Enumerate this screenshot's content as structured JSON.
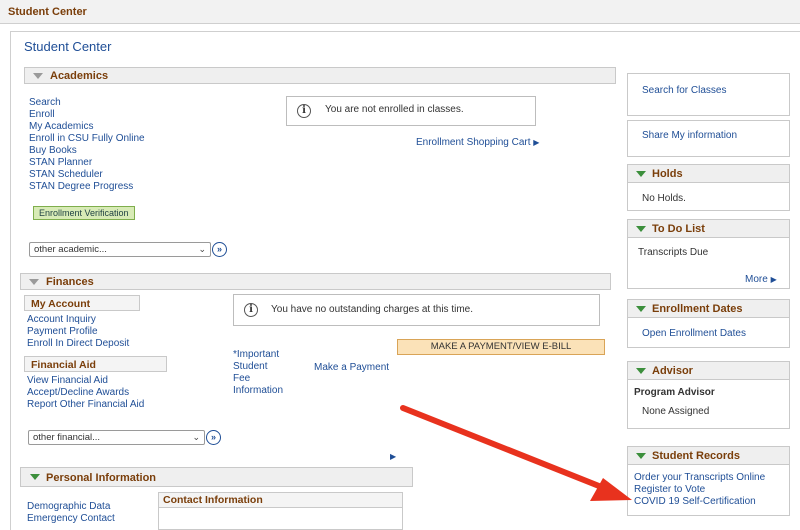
{
  "topbar": {
    "title": "Student Center"
  },
  "page": {
    "title": "Student Center"
  },
  "academics": {
    "header": "Academics",
    "links": [
      "Search",
      "Enroll",
      "My Academics",
      "Enroll in CSU Fully Online",
      "Buy Books",
      "STAN Planner",
      "STAN Scheduler",
      "STAN Degree Progress"
    ],
    "enrollment_verification": "Enrollment Verification",
    "not_enrolled": "You are not enrolled in classes.",
    "shopping_cart": "Enrollment Shopping Cart",
    "other_select": "other academic..."
  },
  "finances": {
    "header": "Finances",
    "my_account": "My Account",
    "account_links": [
      "Account Inquiry",
      "Payment Profile",
      "Enroll In Direct Deposit"
    ],
    "financial_aid": "Financial Aid",
    "aid_links": [
      "View Financial Aid",
      "Accept/Decline Awards",
      "Report Other Financial Aid"
    ],
    "no_charges": "You have no outstanding charges at this time.",
    "pay_button": "MAKE A PAYMENT/VIEW E-BILL",
    "important_info": [
      "*Important",
      "Student",
      "Fee",
      "Information"
    ],
    "make_payment": "Make a Payment",
    "other_select": "other financial..."
  },
  "personal": {
    "header": "Personal Information",
    "links": [
      "Demographic Data",
      "Emergency Contact"
    ],
    "contact_header": "Contact Information"
  },
  "sidebar": {
    "search_classes": "Search for Classes",
    "share_info": "Share My information",
    "holds": {
      "header": "Holds",
      "text": "No Holds."
    },
    "todo": {
      "header": "To Do List",
      "item": "Transcripts Due",
      "more": "More"
    },
    "enrollment_dates": {
      "header": "Enrollment Dates",
      "link": "Open Enrollment Dates"
    },
    "advisor": {
      "header": "Advisor",
      "label": "Program Advisor",
      "value": "None Assigned"
    },
    "student_records": {
      "header": "Student Records",
      "links": [
        "Order your Transcripts Online",
        "Register to Vote",
        "COVID 19 Self-Certification"
      ]
    }
  },
  "colors": {
    "arrow": "#e8321e",
    "link": "#1f4e96",
    "header_text": "#7a3e0a"
  }
}
